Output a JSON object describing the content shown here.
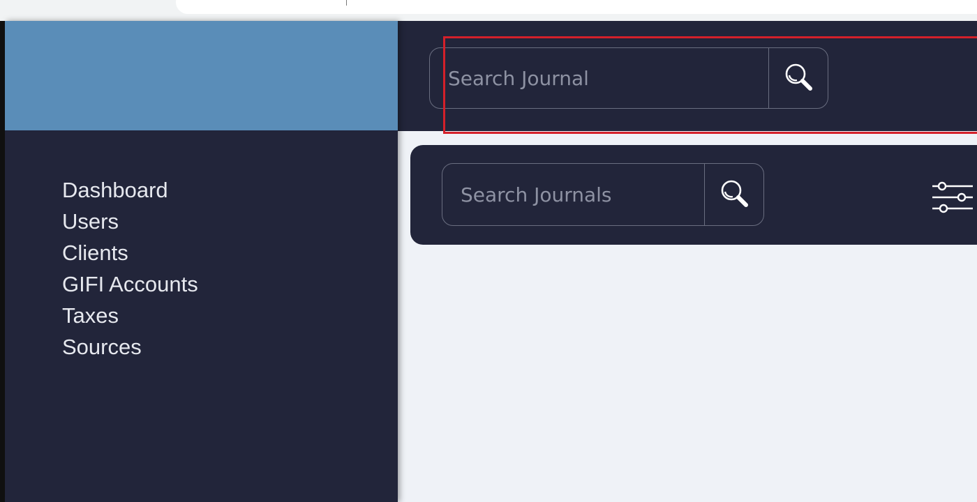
{
  "header": {
    "search_placeholder": "Search Journal"
  },
  "sidebar": {
    "items": [
      {
        "label": "Dashboard"
      },
      {
        "label": "Users"
      },
      {
        "label": "Clients"
      },
      {
        "label": "GIFI Accounts"
      },
      {
        "label": "Taxes"
      },
      {
        "label": "Sources"
      }
    ]
  },
  "toolbar": {
    "search_placeholder": "Search Journals"
  },
  "icons": {
    "search": "search-icon",
    "filter": "sliders-icon"
  },
  "colors": {
    "sidebar_bg": "#22253a",
    "brand_bg": "#5a8db8",
    "content_bg": "#eff2f7",
    "highlight": "#d4202a"
  }
}
